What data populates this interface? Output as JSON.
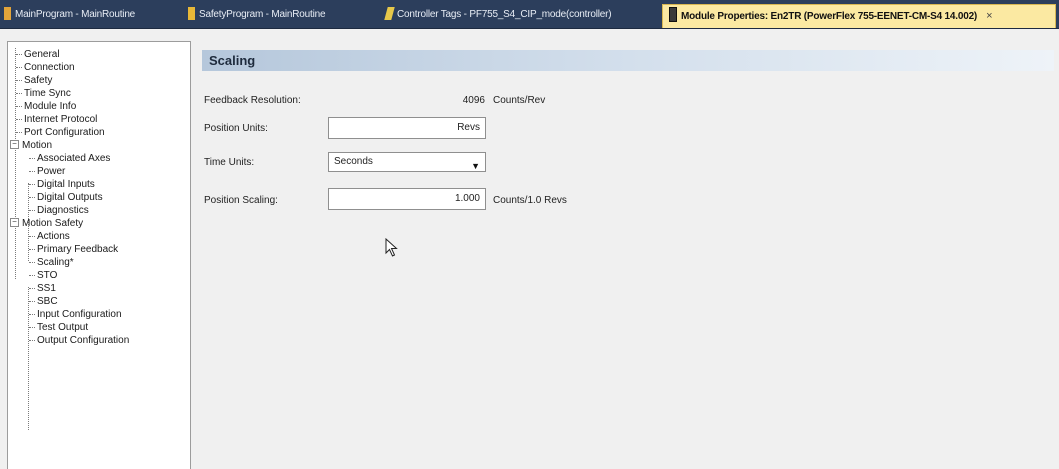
{
  "tabs": [
    {
      "label": "MainProgram - MainRoutine",
      "icon": "ladder-routine-icon"
    },
    {
      "label": "SafetyProgram - MainRoutine",
      "icon": "safety-routine-icon"
    },
    {
      "label": "Controller Tags - PF755_S4_CIP_mode(controller)",
      "icon": "tags-icon"
    },
    {
      "label": "Module Properties: En2TR (PowerFlex 755-EENET-CM-S4 14.002)",
      "icon": "module-icon",
      "active": true,
      "close": "×"
    }
  ],
  "tree": {
    "items": [
      {
        "label": "General"
      },
      {
        "label": "Connection"
      },
      {
        "label": "Safety"
      },
      {
        "label": "Time Sync"
      },
      {
        "label": "Module Info"
      },
      {
        "label": "Internet Protocol"
      },
      {
        "label": "Port Configuration"
      },
      {
        "label": "Motion",
        "expander": "−"
      },
      {
        "label": "Associated Axes"
      },
      {
        "label": "Power"
      },
      {
        "label": "Digital Inputs"
      },
      {
        "label": "Digital Outputs"
      },
      {
        "label": "Diagnostics"
      },
      {
        "label": "Motion Safety",
        "expander": "−"
      },
      {
        "label": "Actions"
      },
      {
        "label": "Primary Feedback"
      },
      {
        "label": "Scaling*"
      },
      {
        "label": "STO"
      },
      {
        "label": "SS1"
      },
      {
        "label": "SBC"
      },
      {
        "label": "Input Configuration"
      },
      {
        "label": "Test Output"
      },
      {
        "label": "Output Configuration"
      }
    ]
  },
  "section": {
    "title": "Scaling"
  },
  "form": {
    "feedback_resolution": {
      "label": "Feedback Resolution:",
      "value": "4096",
      "unit": "Counts/Rev"
    },
    "position_units": {
      "label": "Position Units:",
      "value": "Revs"
    },
    "time_units": {
      "label": "Time Units:",
      "value": "Seconds",
      "arrow": "▼"
    },
    "position_scaling": {
      "label": "Position Scaling:",
      "value": "1.000",
      "unit": "Counts/1.0 Revs"
    }
  },
  "colors": {
    "tabbar": "#2c3e5c",
    "active_tab": "#fbe9a2",
    "header_gradient_start": "#b5c7db"
  }
}
